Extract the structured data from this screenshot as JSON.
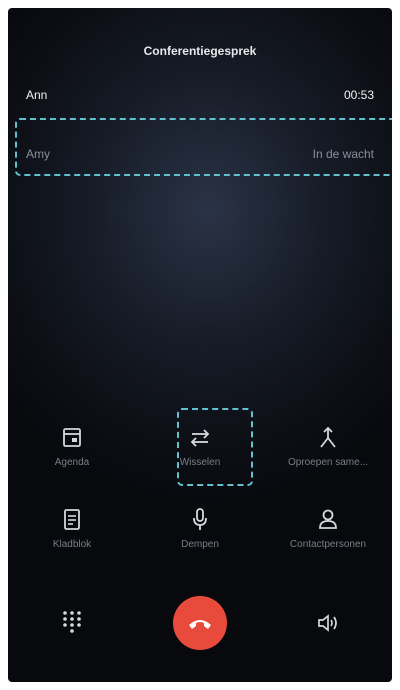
{
  "header": {
    "title": "Conferentiegesprek"
  },
  "calls": [
    {
      "name": "Ann",
      "status": "00:53"
    },
    {
      "name": "Amy",
      "status": "In de wacht"
    }
  ],
  "actions_row1": [
    {
      "label": "Agenda",
      "icon": "calendar-icon"
    },
    {
      "label": "Wisselen",
      "icon": "swap-icon"
    },
    {
      "label": "Oproepen same...",
      "icon": "merge-calls-icon"
    }
  ],
  "actions_row2": [
    {
      "label": "Kladblok",
      "icon": "notepad-icon"
    },
    {
      "label": "Dempen",
      "icon": "microphone-icon"
    },
    {
      "label": "Contactpersonen",
      "icon": "contacts-icon"
    }
  ],
  "bottom_bar": {
    "dialpad_icon": "dialpad-icon",
    "end_call_icon": "end-call-icon",
    "speaker_icon": "speaker-icon",
    "end_call_color": "#e84a3c"
  },
  "highlight_color": "#5fc3cf"
}
